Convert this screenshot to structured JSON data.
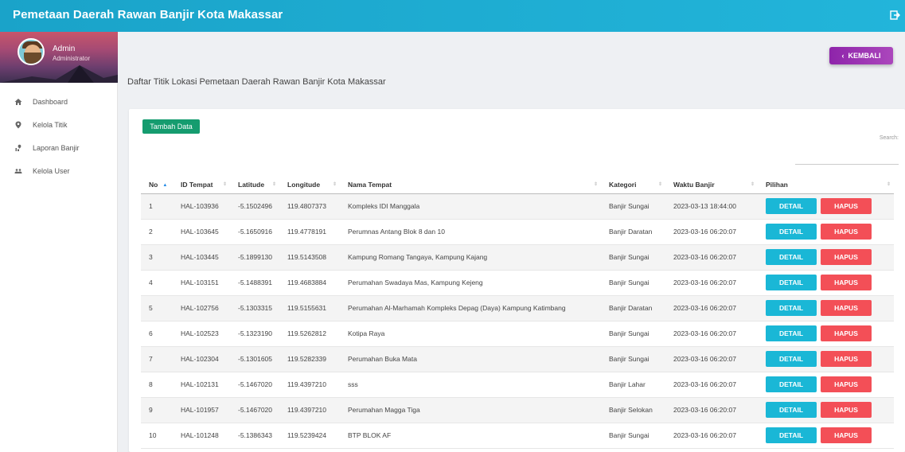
{
  "app": {
    "title": "Pemetaan Daerah Rawan Banjir Kota Makassar",
    "logout_icon": "logout-icon"
  },
  "user": {
    "name": "Admin",
    "role": "Administrator"
  },
  "sidebar": {
    "items": [
      {
        "label": "Dashboard",
        "icon": "home-icon"
      },
      {
        "label": "Kelola Titik",
        "icon": "map-pin-icon"
      },
      {
        "label": "Laporan Banjir",
        "icon": "report-icon"
      },
      {
        "label": "Kelola User",
        "icon": "users-icon"
      }
    ]
  },
  "main": {
    "back_label": "KEMBALI",
    "page_title": "Daftar Titik Lokasi Pemetaan Daerah Rawan Banjir Kota Makassar",
    "add_label": "Tambah Data",
    "search_label": "Search:"
  },
  "table": {
    "headers": [
      "No",
      "ID Tempat",
      "Latitude",
      "Longitude",
      "Nama Tempat",
      "Kategori",
      "Waktu Banjir",
      "Pilihan"
    ],
    "detail_label": "DETAIL",
    "delete_label": "HAPUS",
    "rows": [
      [
        "1",
        "HAL-103936",
        "-5.1502496",
        "119.4807373",
        "Kompleks IDI Manggala",
        "Banjir Sungai",
        "2023-03-13 18:44:00"
      ],
      [
        "2",
        "HAL-103645",
        "-5.1650916",
        "119.4778191",
        "Perumnas Antang Blok 8 dan 10",
        "Banjir Daratan",
        "2023-03-16 06:20:07"
      ],
      [
        "3",
        "HAL-103445",
        "-5.1899130",
        "119.5143508",
        "Kampung Romang Tangaya, Kampung Kajang",
        "Banjir Sungai",
        "2023-03-16 06:20:07"
      ],
      [
        "4",
        "HAL-103151",
        "-5.1488391",
        "119.4683884",
        "Perumahan Swadaya Mas, Kampung Kejeng",
        "Banjir Sungai",
        "2023-03-16 06:20:07"
      ],
      [
        "5",
        "HAL-102756",
        "-5.1303315",
        "119.5155631",
        "Perumahan Al-Marhamah Kompleks Depag (Daya) Kampung Katimbang",
        "Banjir Daratan",
        "2023-03-16 06:20:07"
      ],
      [
        "6",
        "HAL-102523",
        "-5.1323190",
        "119.5262812",
        "Kotipa Raya",
        "Banjir Sungai",
        "2023-03-16 06:20:07"
      ],
      [
        "7",
        "HAL-102304",
        "-5.1301605",
        "119.5282339",
        "Perumahan Buka Mata",
        "Banjir Sungai",
        "2023-03-16 06:20:07"
      ],
      [
        "8",
        "HAL-102131",
        "-5.1467020",
        "119.4397210",
        "sss",
        "Banjir Lahar",
        "2023-03-16 06:20:07"
      ],
      [
        "9",
        "HAL-101957",
        "-5.1467020",
        "119.4397210",
        "Perumahan Magga Tiga",
        "Banjir Selokan",
        "2023-03-16 06:20:07"
      ],
      [
        "10",
        "HAL-101248",
        "-5.1386343",
        "119.5239424",
        "BTP BLOK AF",
        "Banjir Sungai",
        "2023-03-16 06:20:07"
      ]
    ]
  }
}
